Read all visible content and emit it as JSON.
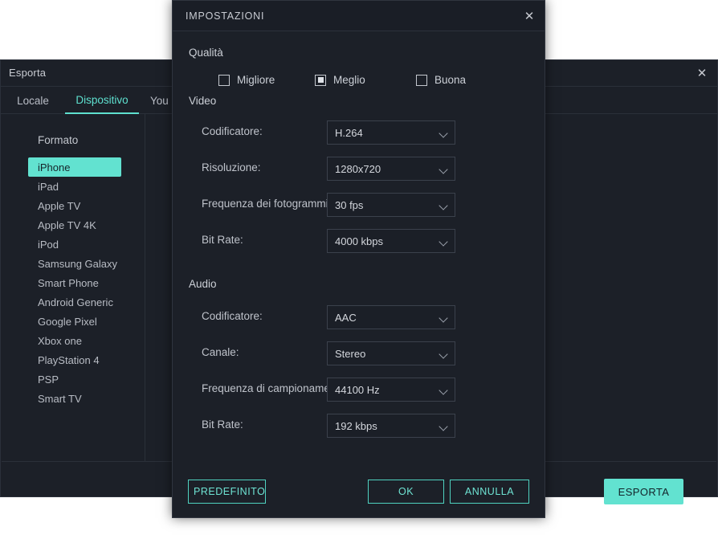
{
  "export_window": {
    "title": "Esporta",
    "close_icon": "close-icon",
    "tabs": [
      {
        "label": "Locale",
        "active": false
      },
      {
        "label": "Dispositivo",
        "active": true
      },
      {
        "label": "You",
        "active": false
      }
    ],
    "format_label": "Formato",
    "devices": [
      {
        "label": "iPhone",
        "selected": true
      },
      {
        "label": "iPad",
        "selected": false
      },
      {
        "label": "Apple TV",
        "selected": false
      },
      {
        "label": "Apple TV 4K",
        "selected": false
      },
      {
        "label": "iPod",
        "selected": false
      },
      {
        "label": "Samsung Galaxy",
        "selected": false
      },
      {
        "label": "Smart Phone",
        "selected": false
      },
      {
        "label": "Android Generic",
        "selected": false
      },
      {
        "label": "Google Pixel",
        "selected": false
      },
      {
        "label": "Xbox one",
        "selected": false
      },
      {
        "label": "PlayStation 4",
        "selected": false
      },
      {
        "label": "PSP",
        "selected": false
      },
      {
        "label": "Smart TV",
        "selected": false
      }
    ],
    "export_button": "ESPORTA"
  },
  "settings_dialog": {
    "title": "IMPOSTAZIONI",
    "close_icon": "close-icon",
    "quality": {
      "section_title": "Qualità",
      "options": [
        {
          "label": "Migliore",
          "checked": false
        },
        {
          "label": "Meglio",
          "checked": true
        },
        {
          "label": "Buona",
          "checked": false
        }
      ]
    },
    "video": {
      "section_title": "Video",
      "fields": [
        {
          "label": "Codificatore:",
          "value": "H.264"
        },
        {
          "label": "Risoluzione:",
          "value": "1280x720"
        },
        {
          "label": "Frequenza dei fotogrammi:",
          "value": "30 fps"
        },
        {
          "label": "Bit Rate:",
          "value": "4000 kbps"
        }
      ]
    },
    "audio": {
      "section_title": "Audio",
      "fields": [
        {
          "label": "Codificatore:",
          "value": "AAC"
        },
        {
          "label": "Canale:",
          "value": "Stereo"
        },
        {
          "label": "Frequenza di campionamento:",
          "value": "44100 Hz"
        },
        {
          "label": "Bit Rate:",
          "value": "192 kbps"
        }
      ]
    },
    "buttons": {
      "default": "PREDEFINITO",
      "ok": "OK",
      "cancel": "ANNULLA"
    }
  },
  "colors": {
    "accent": "#62e2d0",
    "window_bg": "#1c2028",
    "titlebar_bg": "#1a1e26",
    "text": "#c9ccd3",
    "page_bg": "#ffffff"
  }
}
